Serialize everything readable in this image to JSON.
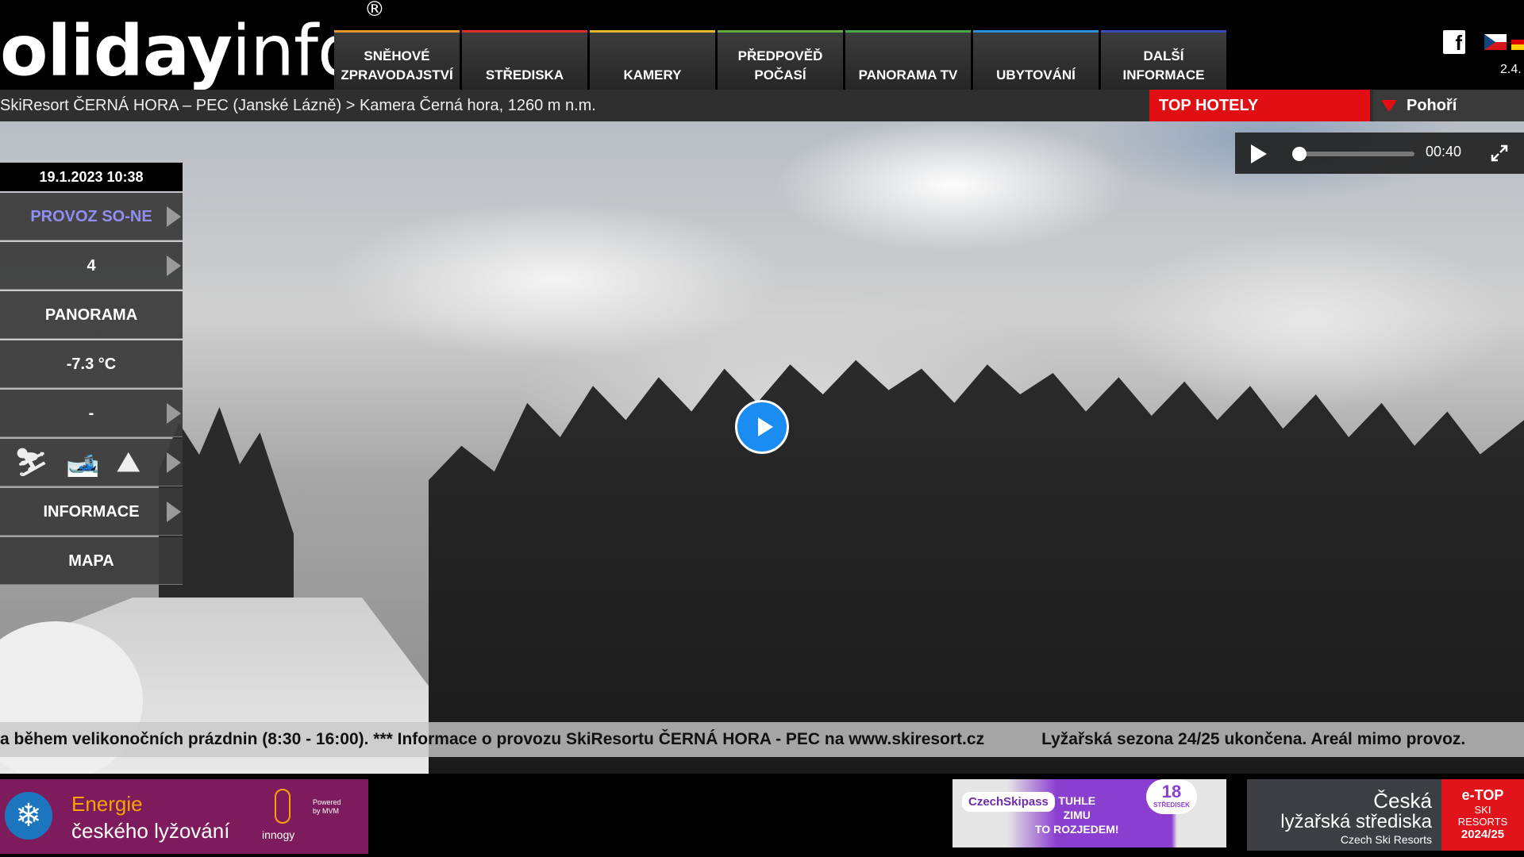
{
  "header": {
    "logo_bold": "oliday",
    "logo_light": "info",
    "logo_mark": "®",
    "nav": [
      {
        "label": "SNĚHOVÉ\nZPRAVODAJSTVÍ",
        "color": "#e5962b"
      },
      {
        "label": "STŘEDISKA",
        "color": "#d8302a"
      },
      {
        "label": "KAMERY",
        "color": "#e6b82a"
      },
      {
        "label": "PŘEDPOVĚĎ\nPOČASÍ",
        "color": "#5fa83c"
      },
      {
        "label": "PANORAMA TV",
        "color": "#48a84a"
      },
      {
        "label": "UBYTOVÁNÍ",
        "color": "#2a8ed8"
      },
      {
        "label": "DALŠÍ\nINFORMACE",
        "color": "#3a4cb5"
      }
    ],
    "social_icon": "facebook-icon",
    "social_glyph": "f",
    "date_partial": "2.4."
  },
  "breadcrumb": {
    "text": "SkiResort ČERNÁ HORA – PEC (Janské Lázně) > Kamera Černá hora, 1260 m n.m.",
    "top_hotely": "TOP HOTELY",
    "pohori": "Pohoří"
  },
  "player": {
    "time": "00:40",
    "progress": 0.0
  },
  "side_menu": {
    "datetime": "19.1.2023 10:38",
    "items": [
      {
        "label": "PROVOZ SO-NE",
        "arrow": true
      },
      {
        "label": "4",
        "arrow": true
      },
      {
        "label": "PANORAMA",
        "arrow": false
      },
      {
        "label": "-7.3 °C",
        "arrow": false
      },
      {
        "label": "-",
        "arrow": true
      },
      {
        "label": "INFORMACE",
        "arrow": true
      },
      {
        "label": "MAPA",
        "arrow": false
      }
    ],
    "activity_icons": [
      "downhill-skier-icon",
      "cross-country-skier-icon",
      "skitouring-icon"
    ]
  },
  "ticker": {
    "part1": "a během velikonočních prázdnin (8:30 - 16:00). *** Informace o provozu SkiResortu ČERNÁ HORA - PEC na www.skiresort.cz",
    "part2": "Lyžařská sezona 24/25 ukončena. Areál mimo provoz."
  },
  "ads": {
    "energie": {
      "line1": "Energie",
      "line2": "českého lyžování",
      "brand": "innogy",
      "powered": "Powered\nby MVM"
    },
    "skipass": {
      "logo": "CzechSkipass",
      "message": "TUHLE\nZIMU\nTO ROZJEDEM!",
      "count": "18",
      "count_label": "STŘEDISEK"
    },
    "ceska": {
      "line1": "Česká",
      "line2": "lyžařská střediska",
      "line3": "Czech Ski Resorts",
      "badge1": "e-TOP",
      "badge2": "SKI\nRESORTS",
      "badge3": "2024/25"
    }
  }
}
